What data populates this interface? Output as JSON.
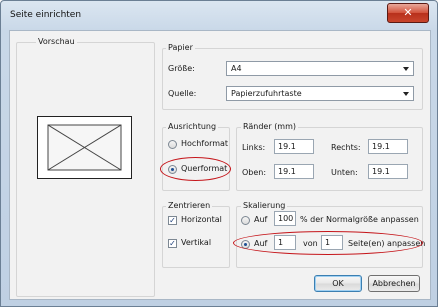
{
  "window": {
    "title": "Seite einrichten",
    "close_icon": "close-icon"
  },
  "preview": {
    "label": "Vorschau"
  },
  "paper": {
    "group_label": "Papier",
    "size_label": "Größe:",
    "size_value": "A4",
    "source_label": "Quelle:",
    "source_value": "Papierzufuhrtaste"
  },
  "orientation": {
    "group_label": "Ausrichtung",
    "portrait_label": "Hochformat",
    "landscape_label": "Querformat",
    "selected": "Querformat"
  },
  "margins": {
    "group_label": "Ränder (mm)",
    "left_label": "Links:",
    "left_value": "19.1",
    "right_label": "Rechts:",
    "right_value": "19.1",
    "top_label": "Oben:",
    "top_value": "19.1",
    "bottom_label": "Unten:",
    "bottom_value": "19.1"
  },
  "centering": {
    "group_label": "Zentrieren",
    "horizontal_label": "Horizontal",
    "horizontal_checked": true,
    "vertical_label": "Vertikal",
    "vertical_checked": true
  },
  "scaling": {
    "group_label": "Skalierung",
    "auf1_label": "Auf",
    "percent_value": "100",
    "percent_suffix": "% der Normalgröße anpassen",
    "auf2_label": "Auf",
    "pages_wide_value": "1",
    "von_label": "von",
    "pages_tall_value": "1",
    "fit_suffix": "Seite(en) anpassen",
    "selected": "fit-to-pages"
  },
  "buttons": {
    "ok": "OK",
    "cancel": "Abbrechen"
  }
}
